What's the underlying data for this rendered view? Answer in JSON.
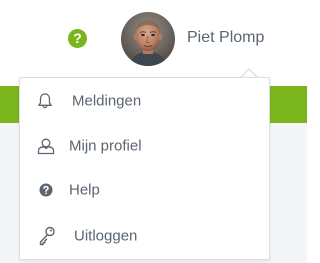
{
  "header": {
    "help_icon_glyph": "?",
    "user_name": "Piet Plomp",
    "help_icon": "question-circle-icon",
    "avatar": "user-avatar-photo"
  },
  "dropdown": {
    "items": [
      {
        "label": "Meldingen",
        "icon": "bell-icon"
      },
      {
        "label": "Mijn profiel",
        "icon": "user-icon"
      },
      {
        "label": "Help",
        "icon": "question-circle-icon"
      },
      {
        "label": "Uitloggen",
        "icon": "key-icon"
      }
    ]
  },
  "colors": {
    "accent_green": "#7ab51d",
    "text": "#5a6570",
    "icon": "#5a6570",
    "background_gray": "#f4f5f7",
    "border": "#dcdfe3"
  }
}
